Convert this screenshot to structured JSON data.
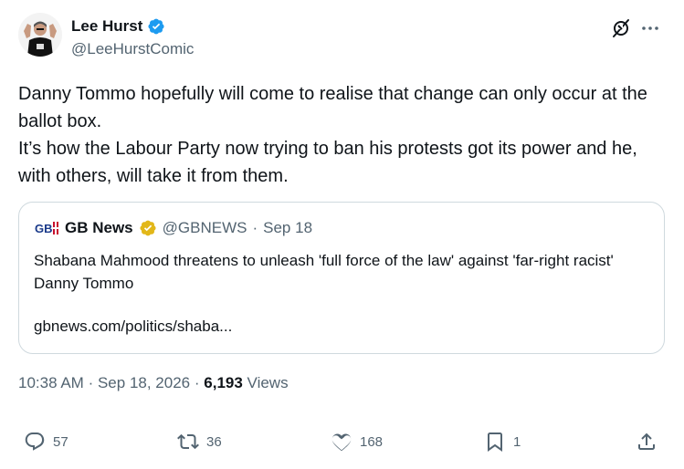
{
  "author": {
    "display_name": "Lee Hurst",
    "handle": "@LeeHurstComic",
    "verified": true
  },
  "tweet": {
    "lines": [
      "Danny Tommo hopefully will come to realise that change can only occur at the ballot box.",
      "It’s how the Labour Party now trying to ban his protests got its power and he, with others, will take it from them."
    ]
  },
  "quote": {
    "logo_text": "GB",
    "display_name": "GB News",
    "handle": "@GBNEWS",
    "separator": "·",
    "date": "Sep 18",
    "text": "Shabana Mahmood threatens to unleash 'full force of the law' against 'far-right racist' Danny Tommo",
    "link": "gbnews.com/politics/shaba..."
  },
  "meta": {
    "time": "10:38 AM",
    "separator": "·",
    "date": "Sep 18, 2026",
    "views_count": "6,193",
    "views_label": "Views"
  },
  "actions": {
    "replies": "57",
    "reposts": "36",
    "likes": "168",
    "bookmarks": "1"
  },
  "colors": {
    "verified_blue": "#1d9bf0",
    "gold_badge": "#e2b719",
    "text_primary": "#0f1419",
    "text_secondary": "#536471",
    "border": "#cfd9de"
  },
  "icons": [
    "verified-badge-icon",
    "grok-icon",
    "more-icon",
    "gb-news-logo",
    "gold-verified-badge-icon",
    "reply-icon",
    "repost-icon",
    "like-icon",
    "bookmark-icon",
    "share-icon"
  ]
}
